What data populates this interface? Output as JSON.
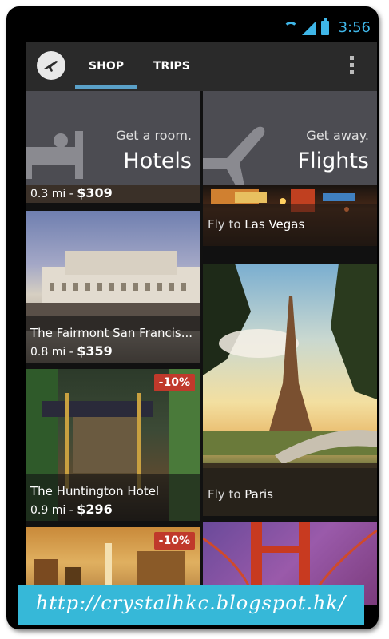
{
  "status_bar": {
    "time": "3:56"
  },
  "action_bar": {
    "tabs": [
      {
        "label": "SHOP"
      },
      {
        "label": "TRIPS"
      }
    ]
  },
  "categories": {
    "hotels": {
      "subtitle": "Get a room.",
      "title": "Hotels"
    },
    "flights": {
      "subtitle": "Get away.",
      "title": "Flights"
    }
  },
  "hotels": [
    {
      "distance": "0.3 mi - ",
      "price": "$309"
    },
    {
      "name": "The Fairmont San Francis...",
      "distance": "0.8 mi - ",
      "price": "$359"
    },
    {
      "name": "The Huntington Hotel",
      "distance": "0.9 mi - ",
      "price": "$296",
      "discount": "-10%"
    },
    {
      "discount": "-10%"
    }
  ],
  "flights": [
    {
      "prefix": "Fly to ",
      "city": "Las Vegas"
    },
    {
      "prefix": "Fly to ",
      "city": "Paris"
    }
  ],
  "watermark": {
    "text": "http://crystalhkc.blogspot.hk/"
  },
  "colors": {
    "accent": "#3fb6e8",
    "tab_underline": "#5aa0c8",
    "discount_badge": "#c0392b",
    "watermark_bg": "#36b8d8"
  }
}
